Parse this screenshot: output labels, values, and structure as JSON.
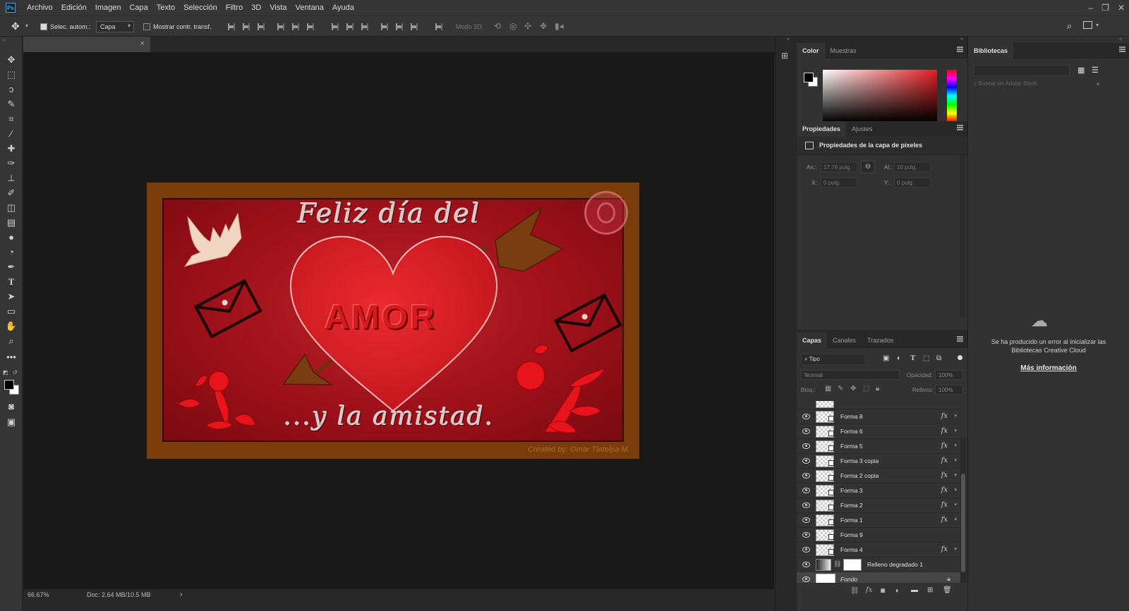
{
  "app": {
    "logo": "Ps"
  },
  "menu": [
    "Archivo",
    "Edición",
    "Imagen",
    "Capa",
    "Texto",
    "Selección",
    "Filtro",
    "3D",
    "Vista",
    "Ventana",
    "Ayuda"
  ],
  "options": {
    "auto_select_label": "Selec. autom.:",
    "auto_select_checked": true,
    "auto_select_target": "Capa",
    "show_transform_label": "Mostrar contr. transf.",
    "show_transform_checked": false,
    "mode_3d_label": "Modo 3D:"
  },
  "document": {
    "close_glyph": "×",
    "zoom": "66.67%",
    "doc_info": "Doc: 2.64 MB/10.5 MB",
    "status_arrow": "›"
  },
  "artwork": {
    "title_line": "Feliz día del",
    "center_word": "AMOR",
    "bottom_line": "...y la amistad.",
    "credit": "Created by: Omar Tlatelpa M.",
    "border_color": "#7a3c08",
    "background_color": "#b0141c",
    "heart_color": "#d41a22",
    "arrow_color": "#7a3d12",
    "dove_color": "#f2d6c4"
  },
  "color_panel": {
    "tabs": [
      "Color",
      "Muestras"
    ],
    "foreground": "#000000",
    "background": "#ffffff",
    "hue": "#e31e24"
  },
  "properties_panel": {
    "tabs": [
      "Propiedades",
      "Ajustes"
    ],
    "header": "Propiedades de la capa de píxeles",
    "width_label": "An.:",
    "width_value": "17.78 pulg.",
    "height_label": "Al.:",
    "height_value": "10 pulg.",
    "x_label": "X:",
    "x_value": "0 pulg.",
    "y_label": "Y:",
    "y_value": "0 pulg."
  },
  "layers_panel": {
    "tabs": [
      "Capas",
      "Canales",
      "Trazados"
    ],
    "filter_kind": "Tipo",
    "blend_mode": "Normal",
    "opacity_label": "Opacidad:",
    "opacity_value": "100%",
    "lock_label": "Bloq.:",
    "fill_label": "Relleno:",
    "fill_value": "100%",
    "fx_glyph": "fx",
    "layers": [
      {
        "name": "Forma 8",
        "fx": true
      },
      {
        "name": "Forma 6",
        "fx": true
      },
      {
        "name": "Forma 5",
        "fx": true
      },
      {
        "name": "Forma 3 copia",
        "fx": true
      },
      {
        "name": "Forma 2 copia",
        "fx": true
      },
      {
        "name": "Forma 3",
        "fx": true
      },
      {
        "name": "Forma 2",
        "fx": true
      },
      {
        "name": "Forma 1",
        "fx": true
      },
      {
        "name": "Forma 9",
        "fx": false
      },
      {
        "name": "Forma 4",
        "fx": true
      },
      {
        "name": "Relleno degradado 1",
        "fx": false
      },
      {
        "name": "Fondo",
        "fx": false,
        "locked": true,
        "selected": true
      }
    ]
  },
  "libraries_panel": {
    "tab": "Bibliotecas",
    "search_placeholder": "Buscar en Adobe Stock",
    "error_message": "Se ha producido un error al inicializar las Bibliotecas Creative Cloud",
    "more_info_link": "Más información"
  }
}
